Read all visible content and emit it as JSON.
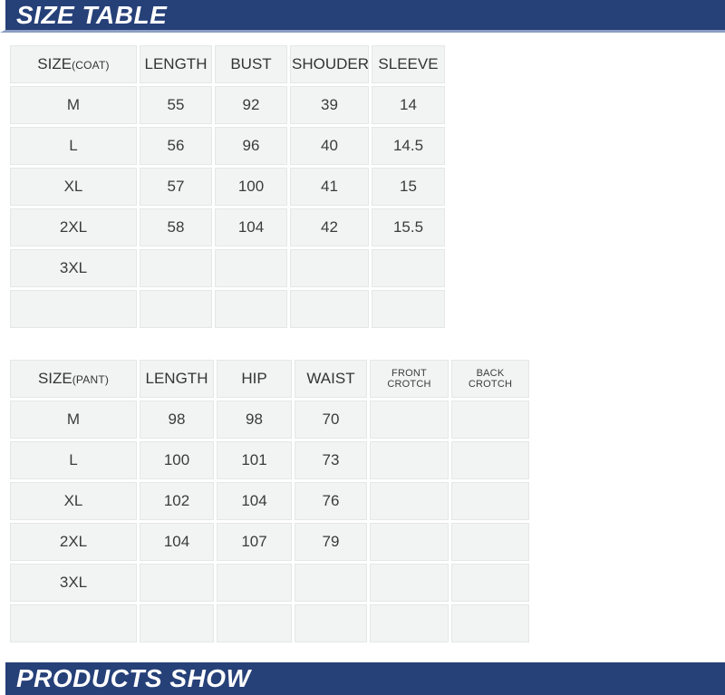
{
  "banners": {
    "top": {
      "title": "SIZE TABLE"
    },
    "bottom": {
      "title": "PRODUCTS SHOW"
    }
  },
  "colors": {
    "banner_navy": "#264078",
    "banner_underline": "#8c9ec4",
    "cell_fill": "#f2f4f4",
    "cell_border": "#e4e7e7",
    "text": "#3b3b3b"
  },
  "coat_table": {
    "headers": [
      {
        "main": "SIZE",
        "sub": "(COAT)"
      },
      {
        "main": "LENGTH",
        "sub": ""
      },
      {
        "main": "BUST",
        "sub": ""
      },
      {
        "main": "SHOUDER",
        "sub": ""
      },
      {
        "main": "SLEEVE",
        "sub": ""
      }
    ],
    "rows": [
      [
        "M",
        "55",
        "92",
        "39",
        "14"
      ],
      [
        "L",
        "56",
        "96",
        "40",
        "14.5"
      ],
      [
        "XL",
        "57",
        "100",
        "41",
        "15"
      ],
      [
        "2XL",
        "58",
        "104",
        "42",
        "15.5"
      ],
      [
        "3XL",
        "",
        "",
        "",
        ""
      ],
      [
        "",
        "",
        "",
        "",
        ""
      ]
    ]
  },
  "pant_table": {
    "headers": [
      {
        "main": "SIZE",
        "sub": "(PANT)",
        "small": false
      },
      {
        "main": "LENGTH",
        "sub": "",
        "small": false
      },
      {
        "main": "HIP",
        "sub": "",
        "small": false
      },
      {
        "main": "WAIST",
        "sub": "",
        "small": false
      },
      {
        "main": "FRONT CROTCH",
        "sub": "",
        "small": true
      },
      {
        "main": "BACK CROTCH",
        "sub": "",
        "small": true
      }
    ],
    "rows": [
      [
        "M",
        "98",
        "98",
        "70",
        "",
        ""
      ],
      [
        "L",
        "100",
        "101",
        "73",
        "",
        ""
      ],
      [
        "XL",
        "102",
        "104",
        "76",
        "",
        ""
      ],
      [
        "2XL",
        "104",
        "107",
        "79",
        "",
        ""
      ],
      [
        "3XL",
        "",
        "",
        "",
        "",
        ""
      ],
      [
        "",
        "",
        "",
        "",
        "",
        ""
      ]
    ]
  }
}
